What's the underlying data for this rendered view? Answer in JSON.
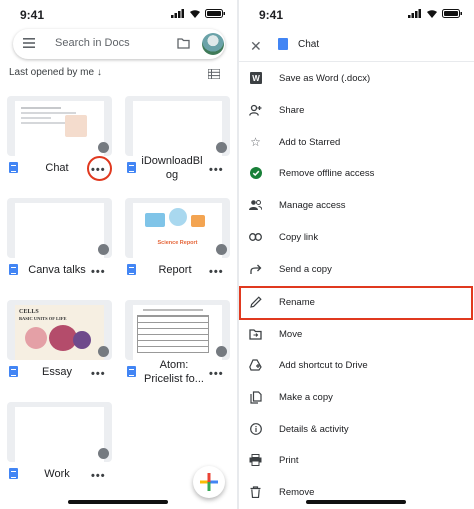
{
  "left": {
    "status_time": "9:41",
    "search_placeholder": "Search in Docs",
    "sort_label": "Last opened by me",
    "files": [
      {
        "name": "Chat"
      },
      {
        "name": "iDownloadBlog"
      },
      {
        "name": "Canva talks"
      },
      {
        "name": "Report"
      },
      {
        "name": "Essay"
      },
      {
        "name": "Atom: Pricelist fo..."
      },
      {
        "name": "Work"
      }
    ],
    "thumb_texts": {
      "report_caption": "Science Report",
      "essay_title": "CELLS",
      "essay_subtitle": "BASIC UNITS OF LIFE"
    }
  },
  "right": {
    "status_time": "9:41",
    "doc_title": "Chat",
    "menu": [
      {
        "label": "Save as Word (.docx)",
        "icon": "word-icon"
      },
      {
        "label": "Share",
        "icon": "add-person-icon"
      },
      {
        "label": "Add to Starred",
        "icon": "star-icon"
      },
      {
        "label": "Remove offline access",
        "icon": "offline-check-icon"
      },
      {
        "label": "Manage access",
        "icon": "people-icon"
      },
      {
        "label": "Copy link",
        "icon": "link-icon"
      },
      {
        "label": "Send a copy",
        "icon": "send-icon"
      },
      {
        "label": "Rename",
        "icon": "pencil-icon"
      },
      {
        "label": "Move",
        "icon": "move-folder-icon"
      },
      {
        "label": "Add shortcut to Drive",
        "icon": "drive-shortcut-icon"
      },
      {
        "label": "Make a copy",
        "icon": "copy-icon"
      },
      {
        "label": "Details & activity",
        "icon": "info-icon"
      },
      {
        "label": "Print",
        "icon": "print-icon"
      },
      {
        "label": "Remove",
        "icon": "trash-icon"
      }
    ]
  },
  "colors": {
    "accent": "#4285f4",
    "highlight": "#e0391f",
    "green": "#188038"
  }
}
